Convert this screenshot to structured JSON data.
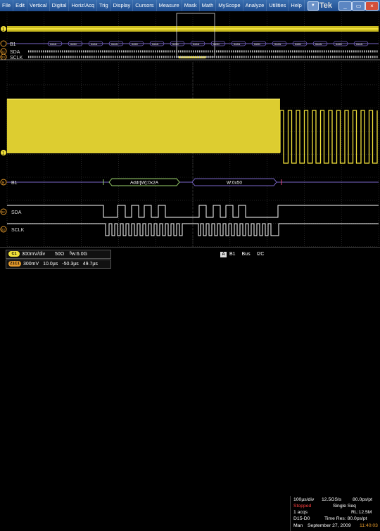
{
  "menu": {
    "items": [
      "File",
      "Edit",
      "Vertical",
      "Digital",
      "Horiz/Acq",
      "Trig",
      "Display",
      "Cursors",
      "Measure",
      "Mask",
      "Math",
      "MyScope",
      "Analyze",
      "Utilities",
      "Help"
    ],
    "dropdown_glyph": "▼"
  },
  "brand": "Tek",
  "window": {
    "minimize": "_",
    "restore": "▭",
    "close": "×"
  },
  "overview": {
    "labels": {
      "ch1": "1",
      "b1": "B1",
      "sda": "SDA",
      "sclk": "SCLK",
      "d2": "D2",
      "d3": "D3"
    },
    "bus_tokens": [
      "0x2A",
      "0x50",
      "0x2A",
      "0x2A",
      "0x50",
      "0x2A",
      "0x50",
      "0x2A",
      "0x50",
      "0x2A",
      "0x50",
      "0x2A",
      "0x50",
      "0x2A",
      "0x50",
      "0x2A"
    ]
  },
  "main": {
    "labels": {
      "ch1": "1",
      "b1": "B1",
      "b1_marker": "B",
      "sda": "SDA",
      "sclk": "SCLK",
      "d2": "D2",
      "d3": "D3"
    },
    "bus_packets": [
      {
        "text": "Addr[W]:0x2A"
      },
      {
        "text": "W:0x50"
      }
    ]
  },
  "status": {
    "ch1": {
      "badge": "C1",
      "scale": "300mV/div",
      "impedance": "50Ω",
      "bandwidth": "ᴮw:6.0G"
    },
    "ch2": {
      "badge": "Z1C1",
      "scale": "300mV",
      "time": "10.0µs",
      "position": "-50.3µs",
      "span": "49.7µs"
    },
    "bus": {
      "badge": "A",
      "name": "B1",
      "kind": "Bus",
      "protocol": "I2C"
    },
    "acq": {
      "timebase": "100µs/div",
      "sample_rate": "12.5GS/s",
      "pt_rate": "80.0ps/pt",
      "state": "Stopped",
      "mode": "Single Seq",
      "acqs": "1 acqs",
      "record_length": "RL:12.5M",
      "digital": "D15-D0",
      "time_res": "Time Res: 80.0ps/pt",
      "trigger_source": "Man",
      "date": "September 27, 2009",
      "time": "11:40:03"
    }
  },
  "colors": {
    "ch1": "#f2e13a",
    "digital": "#ffffff",
    "bus_green": "#9bd36b",
    "stopped": "#ff4040",
    "time": "#e59a2b",
    "grid": "#3b3b3b",
    "bus_line": "#7a66c8"
  }
}
